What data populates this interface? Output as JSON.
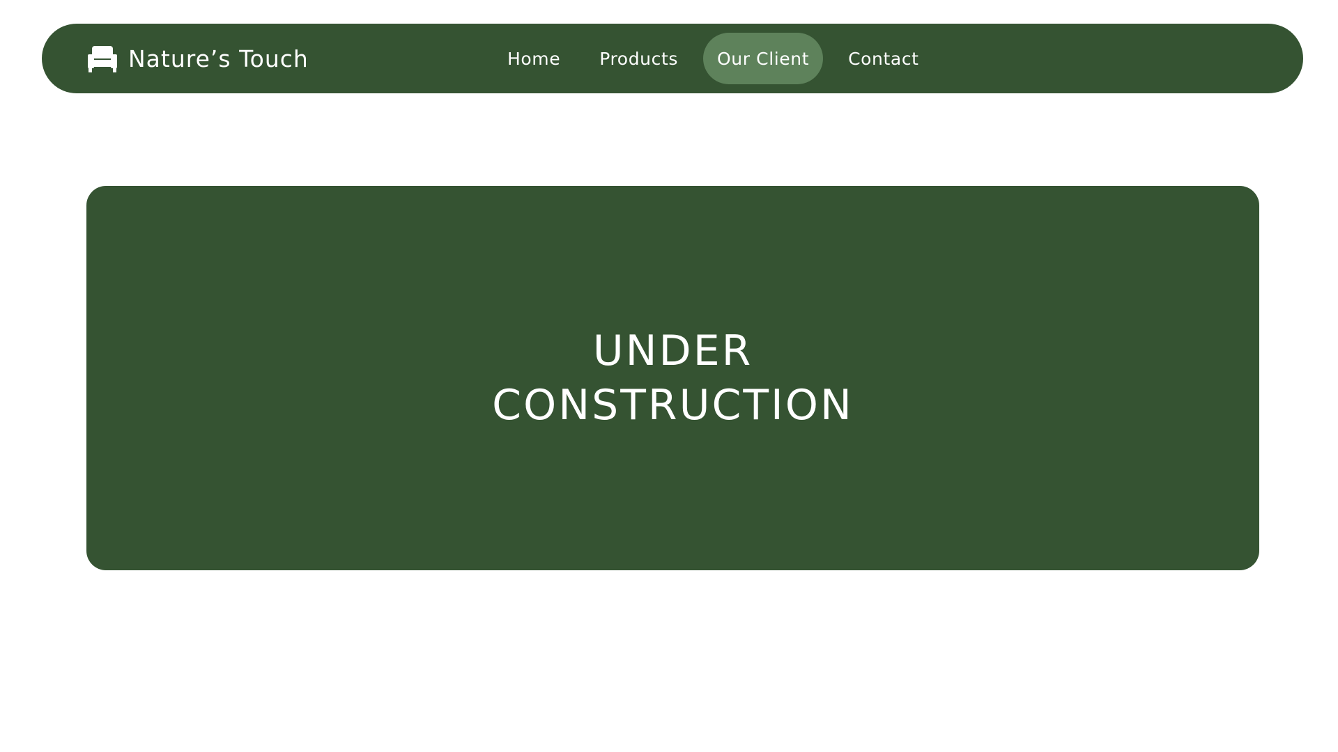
{
  "brand": {
    "name": "Nature’s Touch",
    "icon": "armchair-icon"
  },
  "nav": {
    "items": [
      {
        "label": "Home",
        "active": false
      },
      {
        "label": "Products",
        "active": false
      },
      {
        "label": "Our Client",
        "active": true
      },
      {
        "label": "Contact",
        "active": false
      }
    ]
  },
  "hero": {
    "line1": "UNDER",
    "line2": "CONSTRUCTION"
  },
  "colors": {
    "primary_green": "#355332",
    "active_pill": "#5e825b",
    "text": "#ffffff",
    "background": "#ffffff"
  }
}
